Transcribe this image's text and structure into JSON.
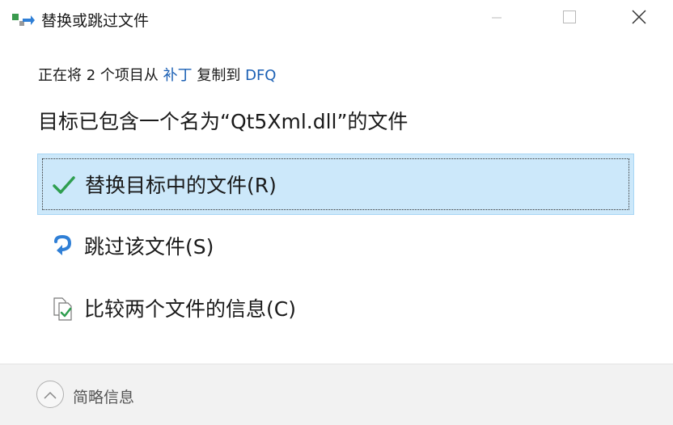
{
  "window": {
    "title": "替换或跳过文件",
    "icon": "file-move-icon"
  },
  "controls": {
    "minimize_icon": "minimize-icon",
    "maximize_icon": "maximize-icon",
    "close_icon": "close-icon"
  },
  "info": {
    "prefix": "正在将 2 个项目从 ",
    "source": "补丁",
    "middle": " 复制到 ",
    "destination": "DFQ",
    "conflict": "目标已包含一个名为“Qt5Xml.dll”的文件"
  },
  "options": {
    "replace": {
      "label": "替换目标中的文件(R)",
      "icon": "checkmark-icon",
      "selected": true
    },
    "skip": {
      "label": "跳过该文件(S)",
      "icon": "skip-arrow-icon"
    },
    "compare": {
      "label": "比较两个文件的信息(C)",
      "icon": "compare-files-icon"
    }
  },
  "footer": {
    "details_label": "简略信息",
    "toggle_icon": "chevron-up-icon"
  },
  "colors": {
    "accent": "#1a5fb4",
    "selection": "#cce8fa",
    "check": "#2e9e4f"
  }
}
